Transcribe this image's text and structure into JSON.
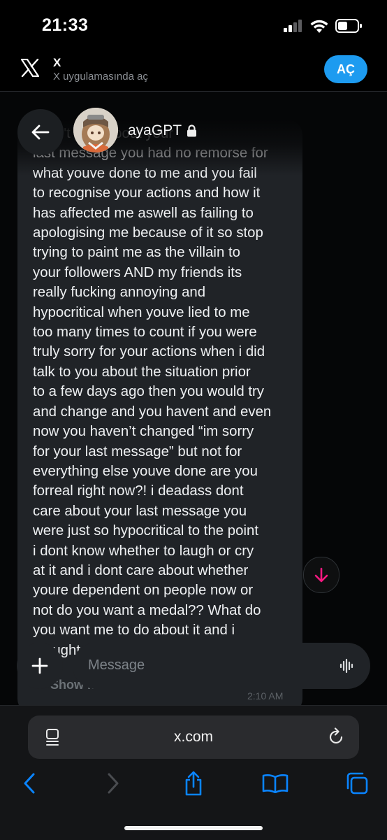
{
  "status_bar": {
    "time": "21:33"
  },
  "banner": {
    "app_name": "X",
    "subtitle": "X uygulamasında aç",
    "open_button": "AÇ"
  },
  "chat": {
    "contact_name": "ayaGPT",
    "message_text": "i don't care about your\nlast message you had no remorse for\nwhat youve done to me and you fail\nto recognise your actions and how it\nhas affected me aswell as failing to\napologising me because of it so stop\ntrying to paint me as the villain to\nyour followers AND my friends its\nreally fucking annoying and\nhypocritical when youve lied to me\ntoo many times to count if you were\ntruly sorry for your actions when i did\ntalk to you about the situation prior\nto a few days ago then you would try\nand change and you havent and even\nnow you haven’t changed “im sorry\nfor your last message” but not for\neverything else youve done are you\nforreal right now?! i deadass dont\ncare about your last message you\nwere just so hypocritical to the point\ni dont know whether to laugh or cry\nat it and i dont care about whether\nyoure dependent on people now or\nnot do you want a medal?? What do\nyou want me to do about it and i\nthought",
    "show_more": "Show more",
    "time": "2:10 AM"
  },
  "composer": {
    "placeholder": "Message"
  },
  "browser": {
    "url": "x.com"
  },
  "icons": {
    "back": "arrow-left-icon",
    "lock": "lock-icon",
    "scroll": "arrow-down-icon",
    "plus": "plus-icon",
    "voice": "waveform-icon",
    "menu": "page-menu-icon",
    "reload": "reload-icon",
    "nav_back": "chevron-left-icon",
    "nav_forward": "chevron-right-icon",
    "share": "share-icon",
    "bookmarks": "book-icon",
    "tabs": "tabs-icon"
  },
  "colors": {
    "accent": "#1d9bf0",
    "scroll_arrow": "#f91880",
    "safari_blue": "#0a84ff"
  }
}
